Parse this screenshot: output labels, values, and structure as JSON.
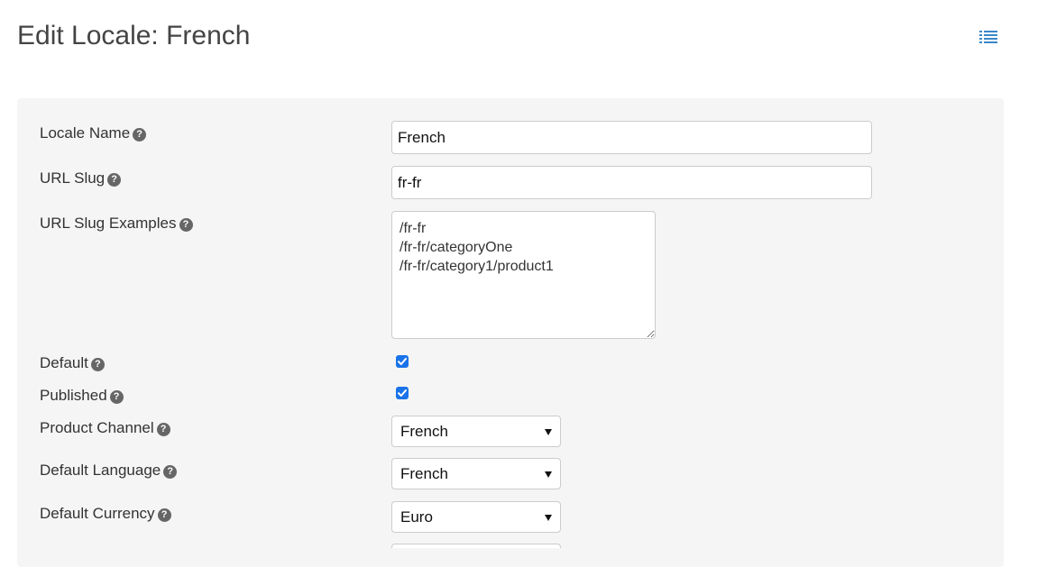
{
  "page": {
    "title": "Edit Locale: French"
  },
  "header": {
    "list_icon": "list-icon"
  },
  "form": {
    "locale_name": {
      "label": "Locale Name",
      "value": "French"
    },
    "url_slug": {
      "label": "URL Slug",
      "value": "fr-fr"
    },
    "url_slug_examples": {
      "label": "URL Slug Examples",
      "value": "/fr-fr\n/fr-fr/categoryOne\n/fr-fr/category1/product1"
    },
    "default": {
      "label": "Default",
      "checked": true
    },
    "published": {
      "label": "Published",
      "checked": true
    },
    "product_channel": {
      "label": "Product Channel",
      "value": "French"
    },
    "default_language": {
      "label": "Default Language",
      "value": "French"
    },
    "default_currency": {
      "label": "Default Currency",
      "value": "Euro"
    },
    "help_glyph": "?"
  },
  "colors": {
    "accent": "#1a73e8",
    "list_icon": "#3a87c8",
    "panel_bg": "#f5f5f5",
    "help_icon": "#666666"
  }
}
